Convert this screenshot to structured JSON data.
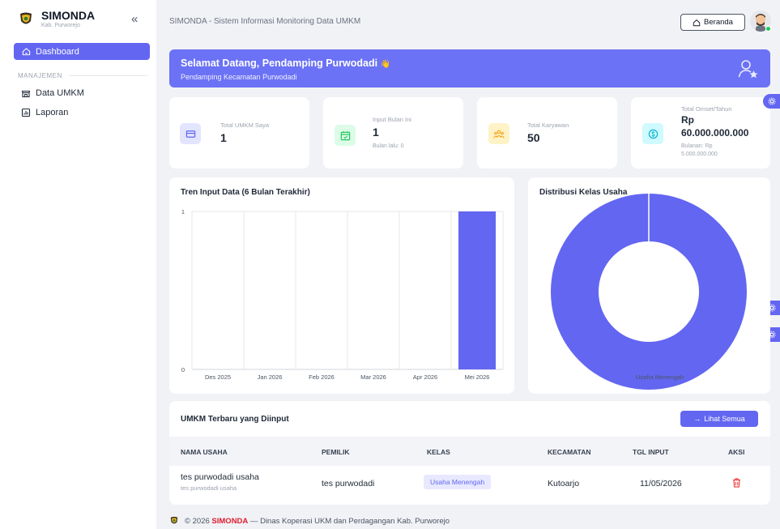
{
  "app": {
    "name": "SIMONDA",
    "subtitle": "Kab. Purworejo",
    "collapse_icon": "«",
    "header_title": "SIMONDA - Sistem Informasi Monitoring Data UMKM"
  },
  "sidebar": {
    "active_item": "Dashboard",
    "section_label": "MANAJEMEN",
    "items": [
      {
        "label": "Data UMKM",
        "icon": "store-icon"
      },
      {
        "label": "Laporan",
        "icon": "chart-report-icon"
      }
    ]
  },
  "topbar": {
    "home_button": "Beranda"
  },
  "banner": {
    "title": "Selamat Datang, Pendamping Purwodadi",
    "emoji": "👋",
    "subtitle": "Pendamping Kecamatan Purwodadi"
  },
  "stats": {
    "total_umkm": {
      "label": "Total UMKM Saya",
      "value": "1"
    },
    "input_month": {
      "label": "Input Bulan Ini",
      "value": "1",
      "sub": "Bulan lalu: 0"
    },
    "employees": {
      "label": "Total Karyawan",
      "value": "50"
    },
    "revenue": {
      "label": "Total Omset/Tahun",
      "currency": "Rp",
      "value": "60.000.000.000",
      "sub1": "Bulanan: Rp",
      "sub2": "5.000.000.000"
    }
  },
  "colors": {
    "accent": "#6366f1",
    "bar": "#6366f1",
    "donut": "#6366f1",
    "delete": "#ef4444"
  },
  "charts": {
    "trend_title": "Tren Input Data (6 Bulan Terakhir)",
    "distribution_title": "Distribusi Kelas Usaha"
  },
  "chart_data": [
    {
      "type": "bar",
      "title": "Tren Input Data (6 Bulan Terakhir)",
      "categories": [
        "Des 2025",
        "Jan 2026",
        "Feb 2026",
        "Mar 2026",
        "Apr 2026",
        "Mei 2026"
      ],
      "values": [
        0,
        0,
        0,
        0,
        0,
        1
      ],
      "yticks": [
        "0",
        "1"
      ],
      "ylim": [
        0,
        1
      ],
      "grid": true
    },
    {
      "type": "pie",
      "title": "Distribusi Kelas Usaha",
      "labels": [
        "Usaha Menengah"
      ],
      "values": [
        1
      ],
      "legend": "bottom"
    }
  ],
  "table": {
    "title": "UMKM Terbaru yang Diinput",
    "see_all": "Lihat Semua",
    "see_all_arrow": "→",
    "headers": [
      "NAMA USAHA",
      "PEMILIK",
      "KELAS",
      "KECAMATAN",
      "TGL INPUT",
      "AKSI"
    ],
    "rows": [
      {
        "name": "tes purwodadi usaha",
        "name_sub": "tes purwodadi usaha",
        "owner": "tes purwodadi",
        "class": "Usaha Menengah",
        "district": "Kutoarjo",
        "date": "11/05/2026",
        "action_icon": "trash-icon"
      }
    ]
  },
  "footer": {
    "prefix": "© 2026",
    "brand": "SIMONDA",
    "suffix": "— Dinas Koperasi UKM dan Perdagangan Kab. Purworejo"
  }
}
